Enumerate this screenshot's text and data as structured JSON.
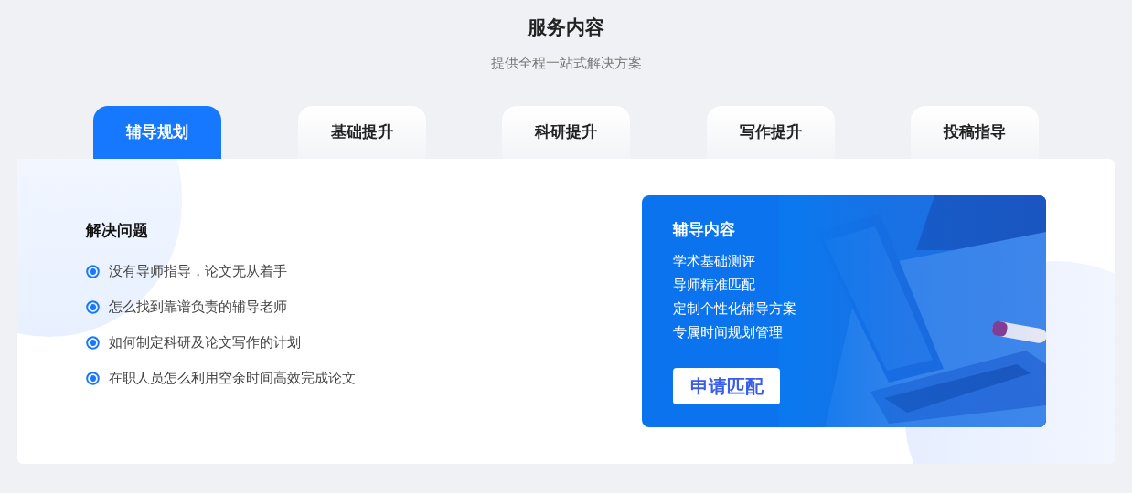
{
  "header": {
    "title": "服务内容",
    "subtitle": "提供全程一站式解决方案"
  },
  "tabs": [
    {
      "label": "辅导规划",
      "selected": true
    },
    {
      "label": "基础提升",
      "selected": false
    },
    {
      "label": "科研提升",
      "selected": false
    },
    {
      "label": "写作提升",
      "selected": false
    },
    {
      "label": "投稿指导",
      "selected": false
    }
  ],
  "problems": {
    "title": "解决问题",
    "items": [
      "没有导师指导，论文无从着手",
      "怎么找到靠谱负责的辅导老师",
      "如何制定科研及论文写作的计划",
      "在职人员怎么利用空余时间高效完成论文"
    ]
  },
  "offer": {
    "title": "辅导内容",
    "items": [
      "学术基础测评",
      "导师精准匹配",
      "定制个性化辅导方案",
      "专属时间规划管理"
    ],
    "button": "申请匹配",
    "background": {
      "kind": "picture"
    }
  }
}
